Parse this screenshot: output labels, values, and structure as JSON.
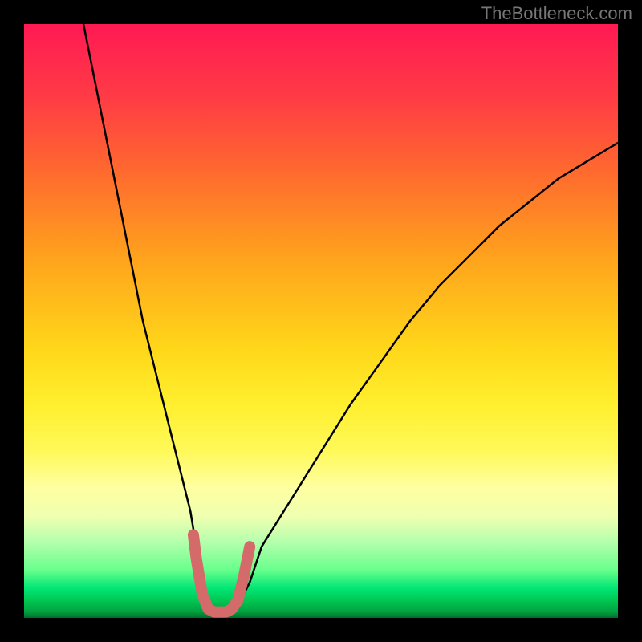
{
  "watermark": "TheBottleneck.com",
  "chart_data": {
    "type": "line",
    "title": "",
    "xlabel": "",
    "ylabel": "",
    "xlim": [
      0,
      100
    ],
    "ylim": [
      0,
      100
    ],
    "curve": {
      "name": "bottleneck-curve",
      "x": [
        10,
        12,
        14,
        16,
        18,
        20,
        22,
        24,
        26,
        28,
        29,
        30,
        31,
        32,
        34,
        36,
        38,
        40,
        45,
        50,
        55,
        60,
        65,
        70,
        75,
        80,
        85,
        90,
        95,
        100
      ],
      "y": [
        100,
        90,
        80,
        70,
        60,
        50,
        42,
        34,
        26,
        18,
        12,
        6,
        2,
        1,
        1,
        2,
        6,
        12,
        20,
        28,
        36,
        43,
        50,
        56,
        61,
        66,
        70,
        74,
        77,
        80
      ]
    },
    "highlight": {
      "name": "optimal-zone",
      "color": "#d46a6a",
      "x": [
        28.5,
        29,
        30,
        31,
        32,
        33,
        34,
        35,
        36,
        37,
        38
      ],
      "y": [
        14,
        10,
        4,
        1.5,
        1,
        1,
        1,
        1.5,
        3,
        7,
        12
      ]
    }
  }
}
